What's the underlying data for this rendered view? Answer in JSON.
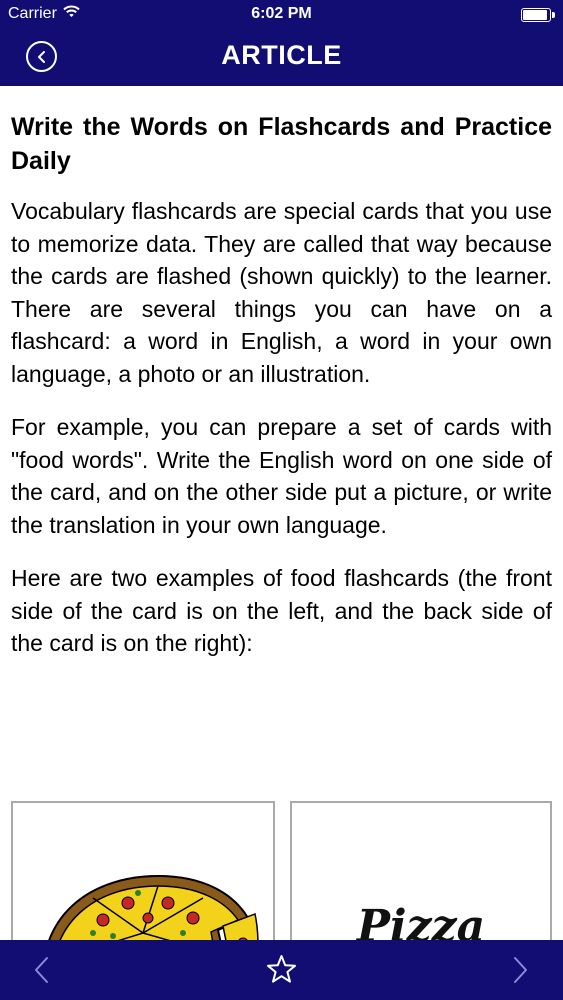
{
  "status_bar": {
    "carrier": "Carrier",
    "time": "6:02 PM",
    "icons": [
      "wifi-icon",
      "battery-icon"
    ]
  },
  "nav": {
    "title": "ARTICLE",
    "back_icon": "back-circle-icon"
  },
  "article": {
    "title": "Write the Words on Flashcards and Practice Daily",
    "paragraphs": [
      "Vocabulary flashcards are special cards that you use to memorize data. They are called that way because the cards are flashed (shown quickly) to the learner. There are several things you can have on a flashcard: a word in English, a word in your own language, a photo or an illustration.",
      "For example, you can prepare a set of cards with \"food words\". Write the English word on one side of the card, and on the other side put a picture, or write the translation in your own language.",
      "Here are two examples of food flashcards (the front side of the card is on the left, and the back side of the card is on the right):"
    ],
    "flashcards": {
      "front_image": "pizza-illustration",
      "back_word": "Pizza"
    }
  },
  "toolbar": {
    "icons": [
      "chevron-left-icon",
      "star-icon",
      "chevron-right-icon"
    ]
  },
  "colors": {
    "bar_background": "#110d73",
    "bar_foreground": "#ffffff",
    "text": "#000000"
  }
}
